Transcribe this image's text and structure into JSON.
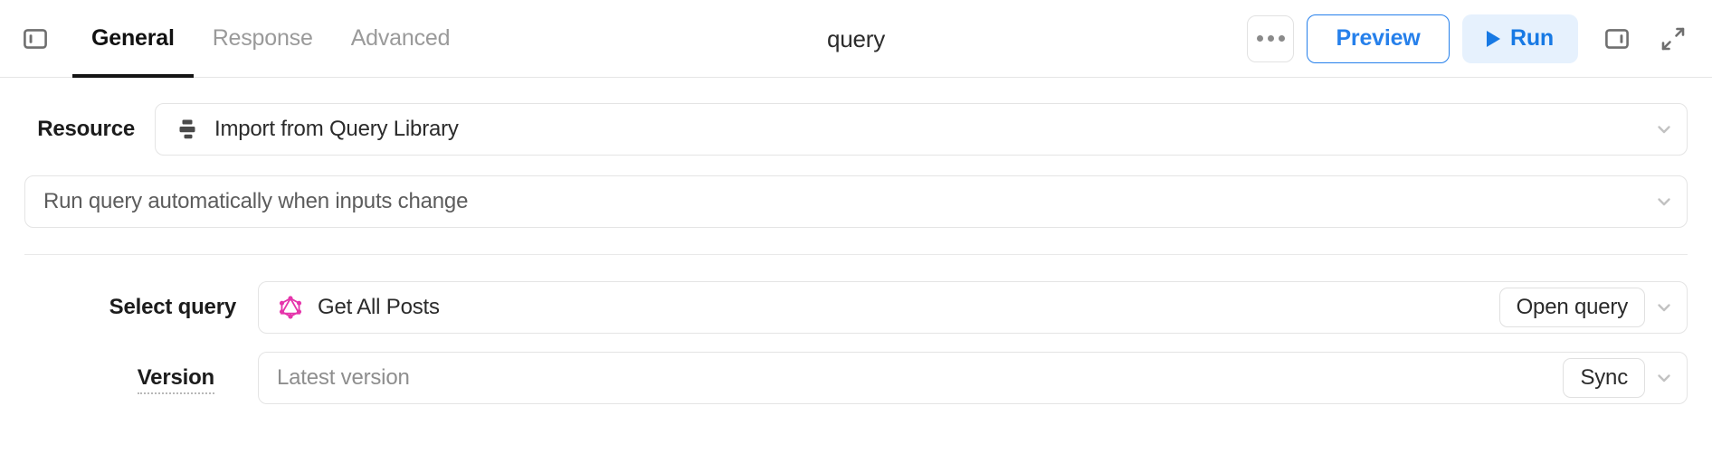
{
  "header": {
    "panel_toggle_left_icon": "panel-left-icon",
    "title": "query",
    "tabs": [
      {
        "label": "General",
        "active": true
      },
      {
        "label": "Response",
        "active": false
      },
      {
        "label": "Advanced",
        "active": false
      }
    ],
    "more_button_label": "•••",
    "preview_label": "Preview",
    "run_label": "Run",
    "run_icon": "play-icon",
    "panel_toggle_right_icon": "panel-right-icon",
    "expand_icon": "expand-diagonal-icon",
    "accent_blue": "#2680eb",
    "run_bg": "#e6f1fd",
    "run_fg": "#1779e4"
  },
  "form": {
    "resource": {
      "label": "Resource",
      "icon": "query-library-icon",
      "value": "Import from Query Library",
      "chevron": "chevron-down-icon"
    },
    "run_mode": {
      "value": "Run query automatically when inputs change",
      "chevron": "chevron-down-icon"
    },
    "select_query": {
      "label": "Select query",
      "icon": "graphql-icon",
      "icon_color": "#e535ab",
      "value": "Get All Posts",
      "action_label": "Open query",
      "chevron": "chevron-down-icon"
    },
    "version": {
      "label": "Version",
      "value": "Latest version",
      "action_label": "Sync",
      "chevron": "chevron-down-icon"
    }
  }
}
